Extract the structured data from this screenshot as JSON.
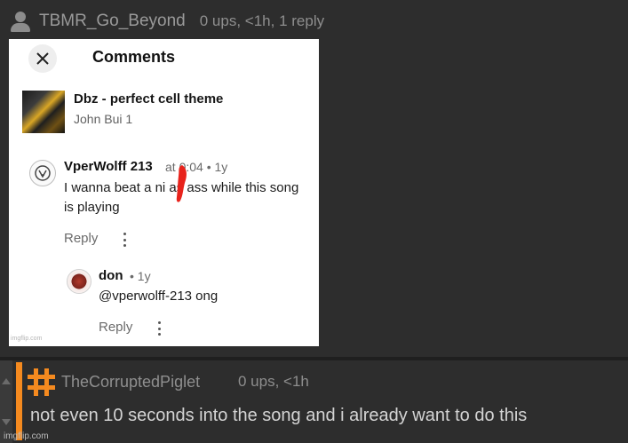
{
  "post": {
    "username": "TBMR_Go_Beyond",
    "meta": "0 ups, <1h, 1 reply"
  },
  "screenshot": {
    "title": "Comments",
    "video": {
      "title": "Dbz - perfect cell theme",
      "channel": "John Bui 1"
    },
    "comment": {
      "author": "VperWolff 213",
      "meta": "at 0:04 • 1y",
      "text": "I wanna beat a ni  as ass while this song is playing",
      "reply_label": "Reply"
    },
    "reply": {
      "author": "don",
      "meta": "• 1y",
      "text": "@vperwolff-213 ong",
      "reply_label": "Reply"
    },
    "watermark": "imgflip.com"
  },
  "comment2": {
    "username": "TheCorruptedPiglet",
    "meta": "0 ups, <1h",
    "text": "not even 10 seconds into the song and i already want to do this"
  },
  "footer": {
    "watermark": "imgflip.com"
  },
  "colors": {
    "background": "#2d2d2d",
    "accent": "#f58a1f",
    "scribble": "#e8231c"
  }
}
